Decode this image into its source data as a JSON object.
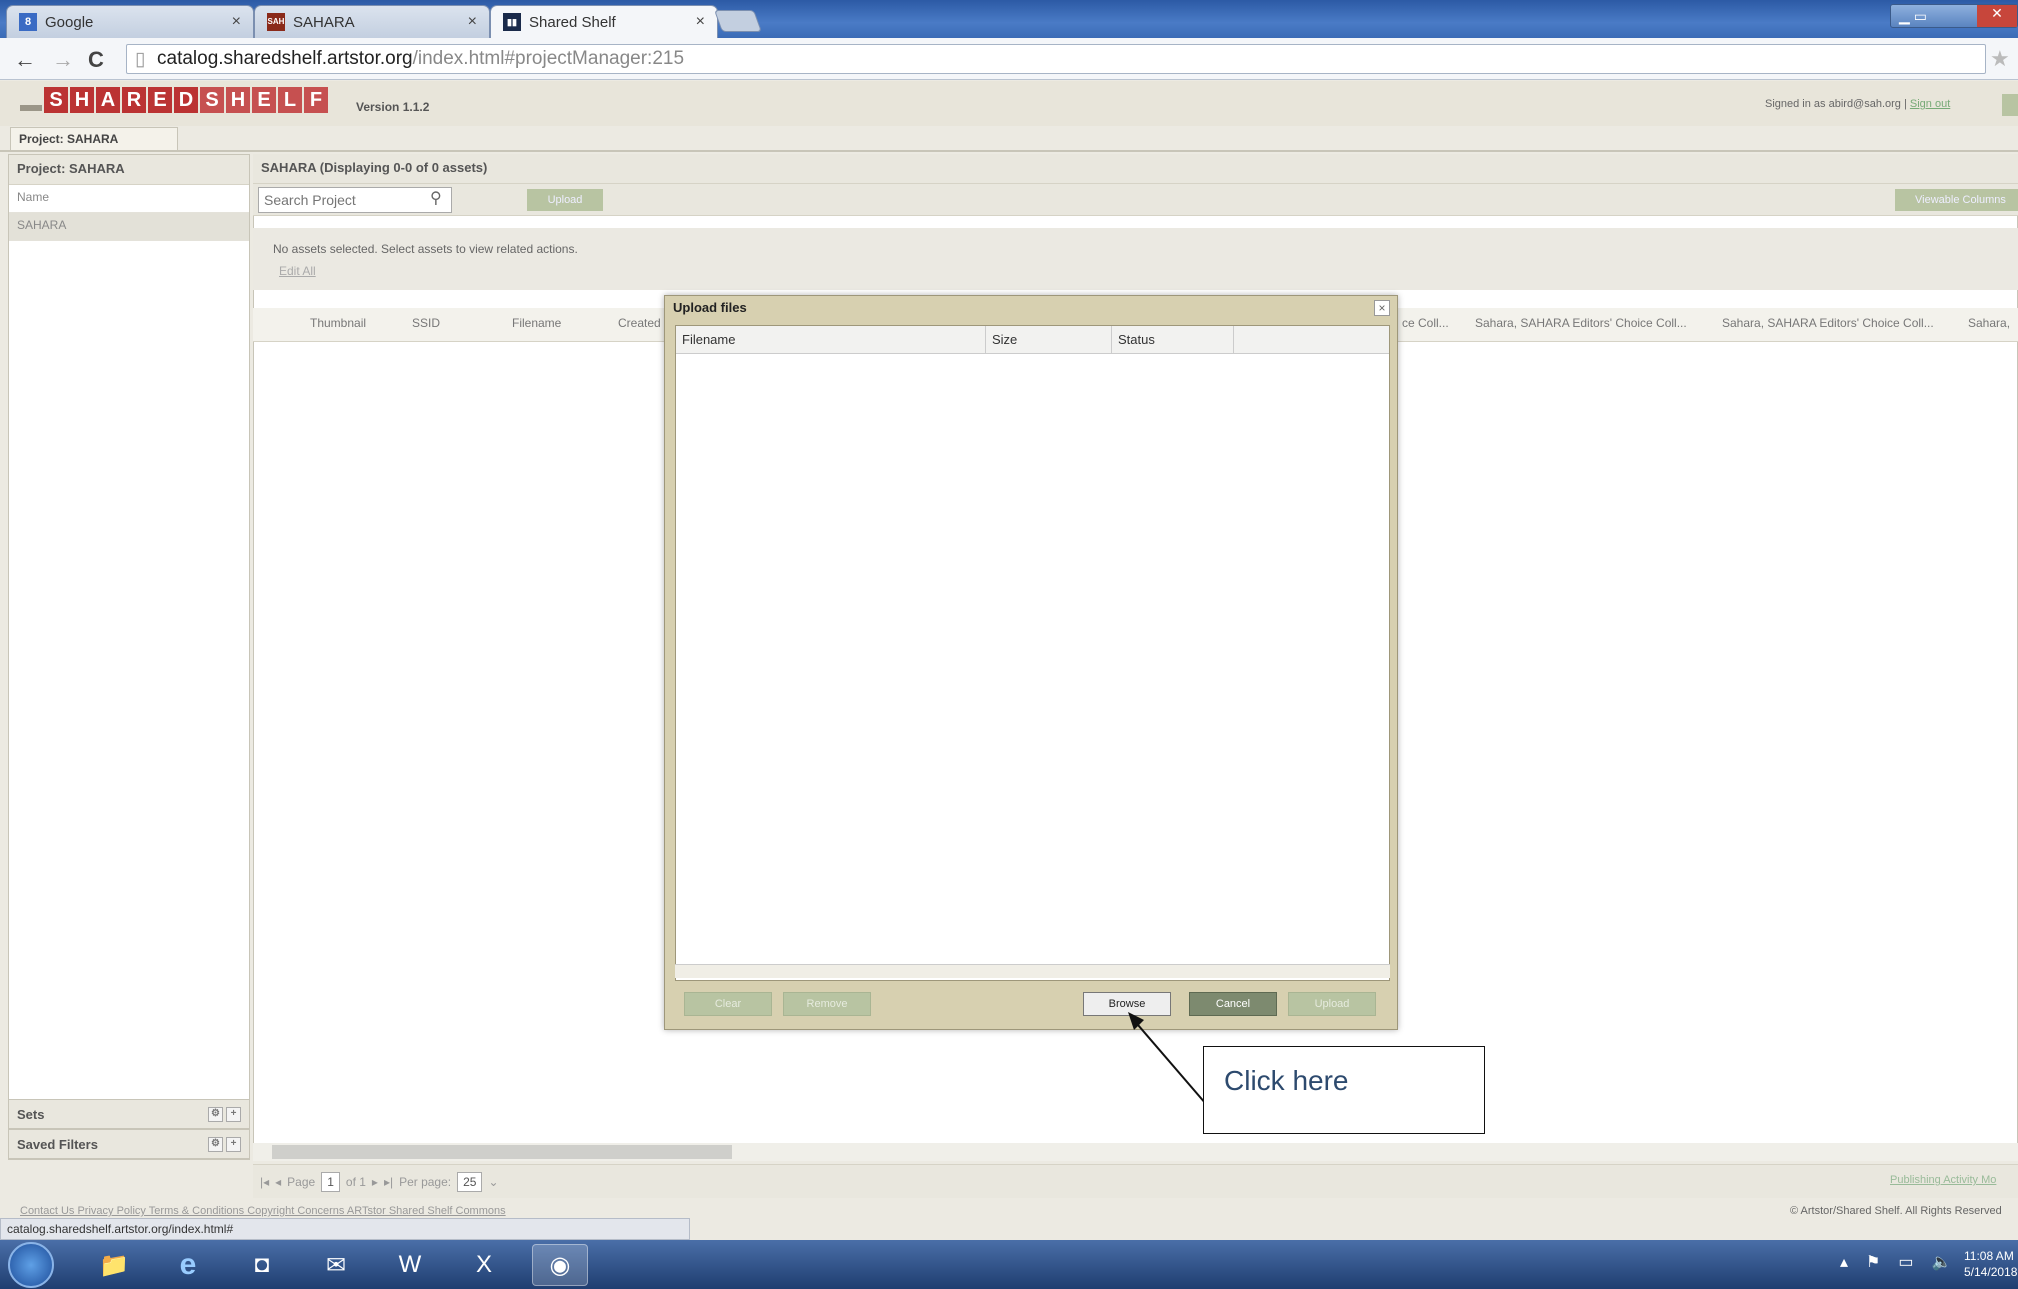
{
  "browser": {
    "tabs": [
      {
        "label": "Google",
        "icon": "google-icon",
        "icon_text": "8",
        "icon_color": "#3a6bc4"
      },
      {
        "label": "SAHARA",
        "icon": "sahara-favicon",
        "icon_text": "SAH",
        "icon_color": "#8a2a1a"
      },
      {
        "label": "Shared Shelf",
        "icon": "shared-shelf-favicon",
        "icon_text": "▮▮",
        "icon_color": "#1a2a4a"
      }
    ],
    "tab_close": "×",
    "url_host": "catalog.sharedshelf.artstor.org",
    "url_path": "/index.html#projectManager:215",
    "back": "←",
    "forward": "→",
    "reload": "C",
    "star": "★"
  },
  "app": {
    "logo_letters": [
      "S",
      "H",
      "A",
      "R",
      "E",
      "D",
      "S",
      "H",
      "E",
      "L",
      "F"
    ],
    "version": "Version 1.1.2",
    "signed_in": "Signed in as abird@sah.org",
    "sign_out": "Sign out",
    "project_tab": "Project: SAHARA"
  },
  "left_panel": {
    "header": "Project: SAHARA",
    "column": "Name",
    "items": [
      "SAHARA"
    ],
    "sets": "Sets",
    "saved_filters": "Saved Filters"
  },
  "main": {
    "header": "SAHARA (Displaying 0-0 of 0 assets)",
    "search_placeholder": "Search Project",
    "upload": "Upload",
    "viewable_columns": "Viewable Columns",
    "no_assets": "No assets selected.  Select assets to view related actions.",
    "edit_all": "Edit All",
    "columns": [
      "Thumbnail",
      "SSID",
      "Filename",
      "Created",
      "ce Coll...",
      "Sahara, SAHARA Editors' Choice Coll...",
      "Sahara, SAHARA Editors' Choice Coll...",
      "Sahara,"
    ]
  },
  "modal": {
    "title": "Upload files",
    "close": "×",
    "headers": [
      "Filename",
      "Size",
      "Status"
    ],
    "buttons": {
      "clear": "Clear",
      "remove": "Remove",
      "browse": "Browse",
      "cancel": "Cancel",
      "upload": "Upload"
    }
  },
  "callout": {
    "text": "Click here"
  },
  "pager": {
    "page_label": "Page",
    "page_value": "1",
    "of": "of 1",
    "per_page_label": "Per page:",
    "per_page_value": "25",
    "publishing": "Publishing Activity Mo"
  },
  "footer": {
    "links": "Contact Us  Privacy Policy  Terms & Conditions  Copyright Concerns  ARTstor  Shared Shelf Commons",
    "copyright": "© Artstor/Shared Shelf. All Rights Reserved",
    "status_url": "catalog.sharedshelf.artstor.org/index.html#"
  },
  "taskbar": {
    "icons": [
      "explorer-icon",
      "internet-explorer-icon",
      "outlook-icon",
      "mail-icon",
      "word-icon",
      "excel-icon",
      "chrome-icon"
    ],
    "time": "11:08 AM",
    "date": "5/14/2018"
  }
}
